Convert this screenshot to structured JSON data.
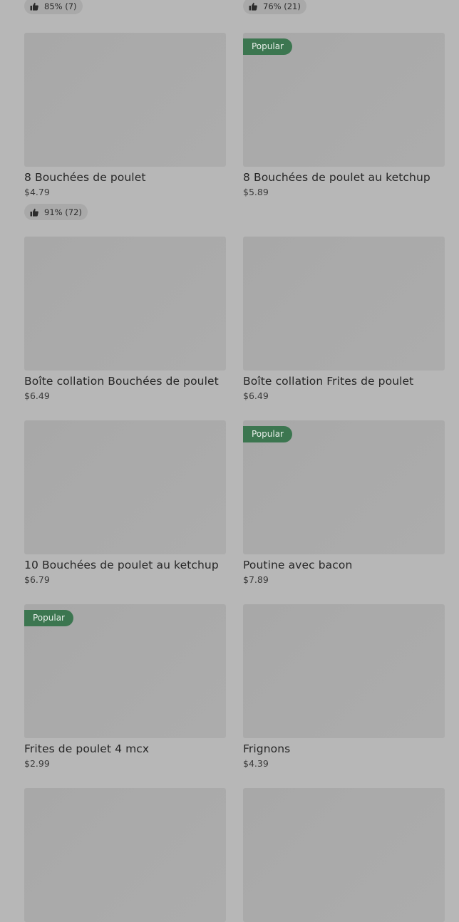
{
  "top_ratings": [
    {
      "text": "85% (7)"
    },
    {
      "text": "76% (21)"
    }
  ],
  "items": [
    {
      "title": "8 Bouchées de poulet",
      "price": "$4.79",
      "badge": "",
      "rating": "91% (72)"
    },
    {
      "title": "8 Bouchées de poulet au ketchup",
      "price": "$5.89",
      "badge": "Popular",
      "rating": ""
    },
    {
      "title": "Boîte collation Bouchées de poulet",
      "price": "$6.49",
      "badge": "",
      "rating": ""
    },
    {
      "title": "Boîte collation Frites de poulet",
      "price": "$6.49",
      "badge": "",
      "rating": ""
    },
    {
      "title": "10 Bouchées de poulet au ketchup",
      "price": "$6.79",
      "badge": "",
      "rating": ""
    },
    {
      "title": "Poutine avec bacon",
      "price": "$7.89",
      "badge": "Popular",
      "rating": ""
    },
    {
      "title": "Frites de poulet 4 mcx",
      "price": "$2.99",
      "badge": "Popular",
      "rating": ""
    },
    {
      "title": "Frignons",
      "price": "$4.39",
      "badge": "",
      "rating": ""
    }
  ]
}
